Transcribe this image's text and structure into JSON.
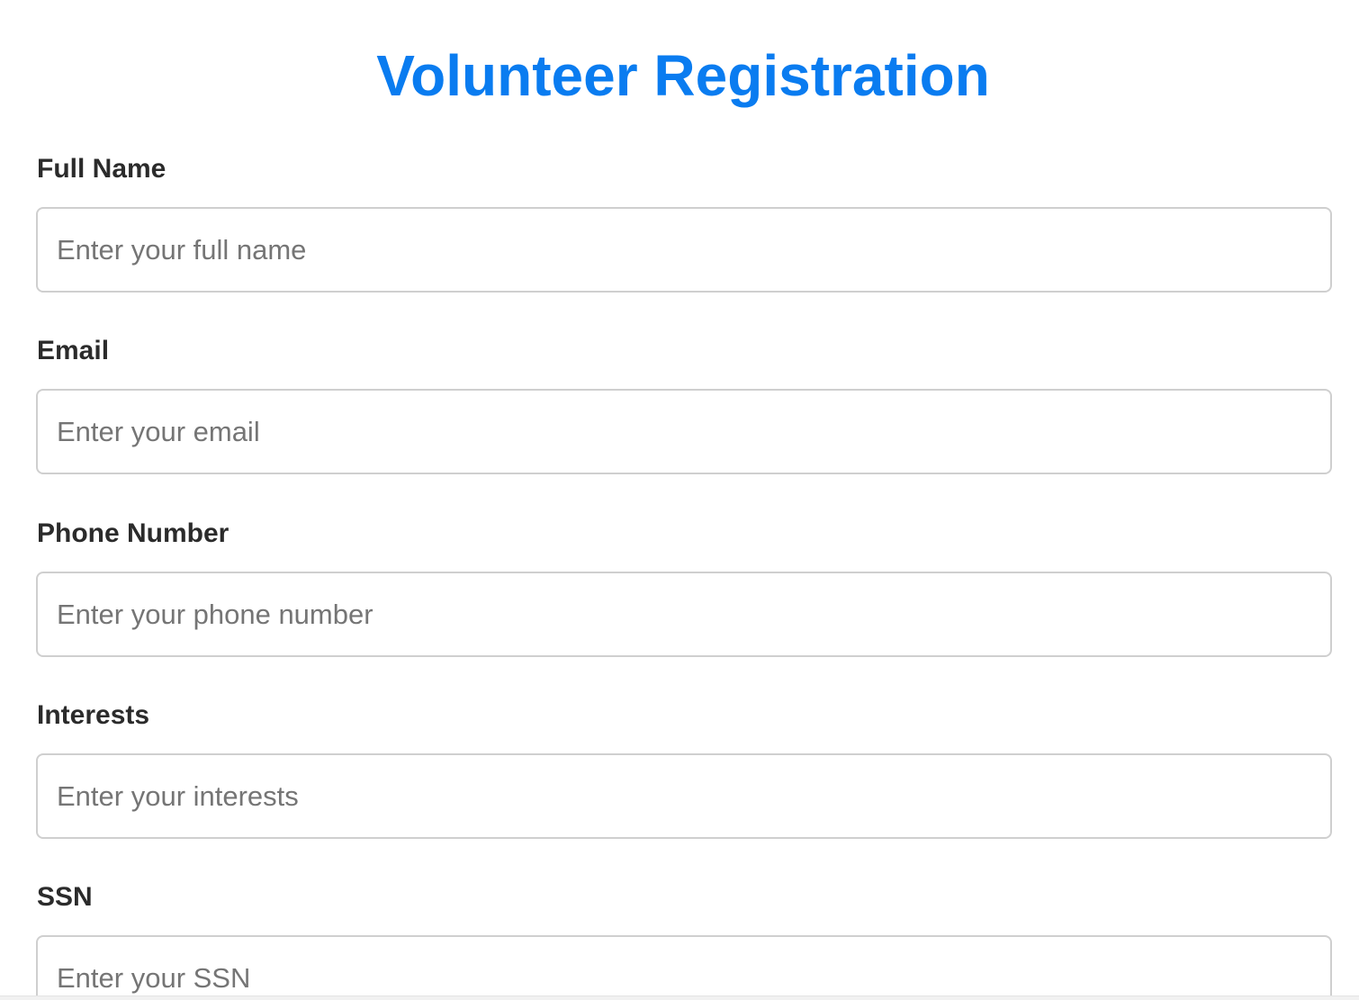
{
  "form": {
    "title": "Volunteer Registration",
    "accent_color": "#0a7cf0",
    "fields": [
      {
        "label": "Full Name",
        "placeholder": "Enter your full name",
        "value": ""
      },
      {
        "label": "Email",
        "placeholder": "Enter your email",
        "value": ""
      },
      {
        "label": "Phone Number",
        "placeholder": "Enter your phone number",
        "value": ""
      },
      {
        "label": "Interests",
        "placeholder": "Enter your interests",
        "value": ""
      },
      {
        "label": "SSN",
        "placeholder": "Enter your SSN",
        "value": ""
      }
    ]
  }
}
